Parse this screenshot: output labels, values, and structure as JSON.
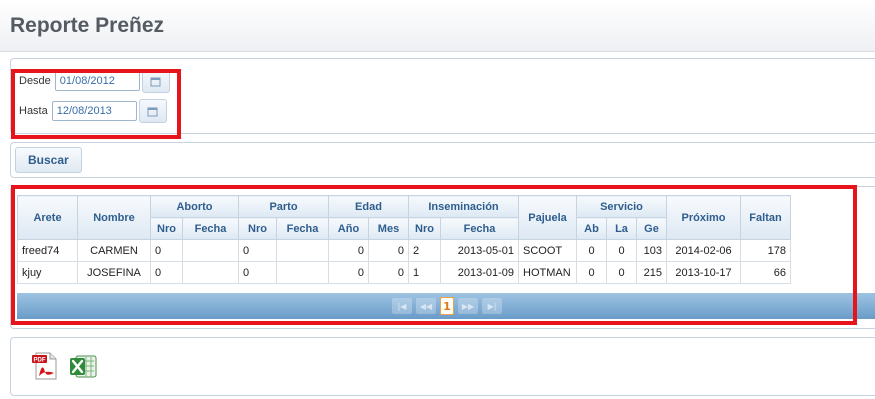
{
  "page": {
    "title": "Reporte Preñez"
  },
  "filters": {
    "desde_label": "Desde",
    "desde_value": "01/08/2012",
    "hasta_label": "Hasta",
    "hasta_value": "12/08/2013"
  },
  "actions": {
    "buscar_label": "Buscar"
  },
  "table": {
    "groups": {
      "arete": "Arete",
      "nombre": "Nombre",
      "aborto": "Aborto",
      "parto": "Parto",
      "edad": "Edad",
      "inseminacion": "Inseminación",
      "pajuela": "Pajuela",
      "servicio": "Servicio",
      "proximo": "Próximo",
      "faltan": "Faltan"
    },
    "sub": {
      "aborto_nro": "Nro",
      "aborto_fecha": "Fecha",
      "parto_nro": "Nro",
      "parto_fecha": "Fecha",
      "edad_ano": "Año",
      "edad_mes": "Mes",
      "insem_nro": "Nro",
      "insem_fecha": "Fecha",
      "serv_ab": "Ab",
      "serv_la": "La",
      "serv_ge": "Ge"
    },
    "rows": [
      {
        "arete": "freed74",
        "nombre": "CARMEN",
        "aborto_nro": "0",
        "aborto_fecha": "",
        "parto_nro": "0",
        "parto_fecha": "",
        "edad_ano": "0",
        "edad_mes": "0",
        "insem_nro": "2",
        "insem_fecha": "2013-05-01",
        "pajuela": "SCOOT",
        "serv_ab": "0",
        "serv_la": "0",
        "serv_ge": "103",
        "proximo": "2014-02-06",
        "faltan": "178"
      },
      {
        "arete": "kjuy",
        "nombre": "JOSEFINA",
        "aborto_nro": "0",
        "aborto_fecha": "",
        "parto_nro": "0",
        "parto_fecha": "",
        "edad_ano": "0",
        "edad_mes": "0",
        "insem_nro": "1",
        "insem_fecha": "2013-01-09",
        "pajuela": "HOTMAN",
        "serv_ab": "0",
        "serv_la": "0",
        "serv_ge": "215",
        "proximo": "2013-10-17",
        "faltan": "66"
      }
    ]
  },
  "pager": {
    "current_page": "1"
  },
  "export": {
    "icons": [
      "pdf-icon",
      "excel-icon"
    ]
  },
  "annotations": {
    "highlight_color": "#e8141b"
  }
}
